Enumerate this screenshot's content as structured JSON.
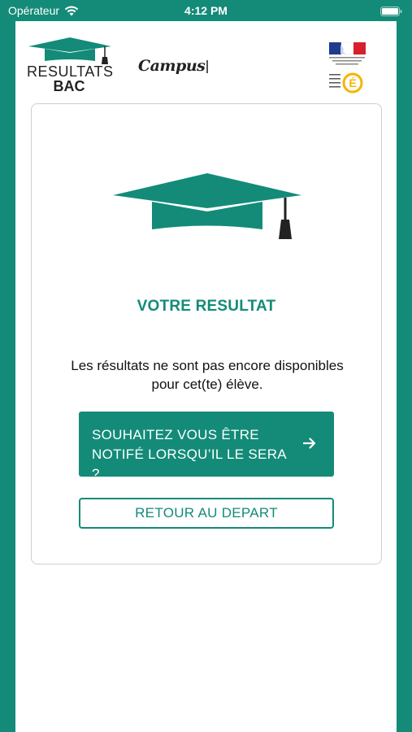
{
  "status_bar": {
    "carrier": "Opérateur",
    "time": "4:12 PM",
    "wifi_icon": "wifi-icon",
    "battery_icon": "battery-icon"
  },
  "header": {
    "logo_line1": "RESULTATS",
    "logo_line2": "BAC",
    "partner_logo": "Campus",
    "ministry_logo_icon": "marianne-flag-icon",
    "education_logo_icon": "education-nationale-icon"
  },
  "card": {
    "icon": "graduation-cap-icon",
    "title": "VOTRE RESULTAT",
    "message": "Les résultats ne sont pas encore disponibles pour cet(te) élève.",
    "notify_button": "SOUHAITEZ VOUS ÊTRE NOTIFÉ LORSQU’IL LE SERA ?",
    "back_button": "RETOUR AU DEPART"
  },
  "colors": {
    "brand": "#138b78",
    "background": "#ffffff",
    "text": "#111111"
  }
}
